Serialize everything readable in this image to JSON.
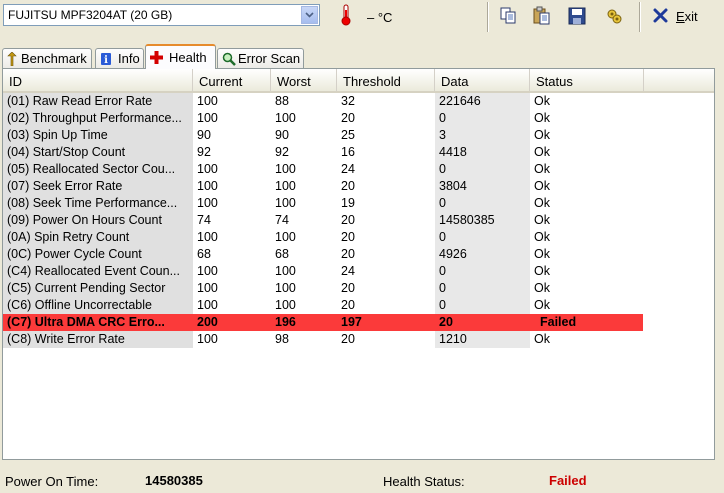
{
  "toolbar": {
    "drive": "FUJITSU MPF3204AT (20 GB)",
    "temperature": "– °C",
    "exit_label_first": "E",
    "exit_label_rest": "xit",
    "icons": [
      "copy-icon",
      "paste-icon",
      "save-icon",
      "options-icon",
      "exit-icon"
    ]
  },
  "tabs": [
    {
      "label": "Benchmark",
      "icon": "benchmark-icon",
      "active": false
    },
    {
      "label": "Info",
      "icon": "info-icon",
      "active": false
    },
    {
      "label": "Health",
      "icon": "health-cross-icon",
      "active": true
    },
    {
      "label": "Error Scan",
      "icon": "magnifier-icon",
      "active": false
    }
  ],
  "table": {
    "columns": [
      "ID",
      "Current",
      "Worst",
      "Threshold",
      "Data",
      "Status"
    ],
    "rows": [
      {
        "id": "(01) Raw Read Error Rate",
        "current": "100",
        "worst": "88",
        "threshold": "32",
        "data": "221646",
        "status": "Ok"
      },
      {
        "id": "(02) Throughput Performance...",
        "current": "100",
        "worst": "100",
        "threshold": "20",
        "data": "0",
        "status": "Ok"
      },
      {
        "id": "(03) Spin Up Time",
        "current": "90",
        "worst": "90",
        "threshold": "25",
        "data": "3",
        "status": "Ok"
      },
      {
        "id": "(04) Start/Stop Count",
        "current": "92",
        "worst": "92",
        "threshold": "16",
        "data": "4418",
        "status": "Ok"
      },
      {
        "id": "(05) Reallocated Sector Cou...",
        "current": "100",
        "worst": "100",
        "threshold": "24",
        "data": "0",
        "status": "Ok"
      },
      {
        "id": "(07) Seek Error Rate",
        "current": "100",
        "worst": "100",
        "threshold": "20",
        "data": "3804",
        "status": "Ok"
      },
      {
        "id": "(08) Seek Time Performance...",
        "current": "100",
        "worst": "100",
        "threshold": "19",
        "data": "0",
        "status": "Ok"
      },
      {
        "id": "(09) Power On Hours Count",
        "current": "74",
        "worst": "74",
        "threshold": "20",
        "data": "14580385",
        "status": "Ok"
      },
      {
        "id": "(0A) Spin Retry Count",
        "current": "100",
        "worst": "100",
        "threshold": "20",
        "data": "0",
        "status": "Ok"
      },
      {
        "id": "(0C) Power Cycle Count",
        "current": "68",
        "worst": "68",
        "threshold": "20",
        "data": "4926",
        "status": "Ok"
      },
      {
        "id": "(C4) Reallocated Event Coun...",
        "current": "100",
        "worst": "100",
        "threshold": "24",
        "data": "0",
        "status": "Ok"
      },
      {
        "id": "(C5) Current Pending Sector",
        "current": "100",
        "worst": "100",
        "threshold": "20",
        "data": "0",
        "status": "Ok"
      },
      {
        "id": "(C6) Offline Uncorrectable",
        "current": "100",
        "worst": "100",
        "threshold": "20",
        "data": "0",
        "status": "Ok"
      },
      {
        "id": "(C7) Ultra DMA CRC Erro...",
        "current": "200",
        "worst": "196",
        "threshold": "197",
        "data": "20",
        "status": "Failed",
        "failed": true
      },
      {
        "id": "(C8) Write Error Rate",
        "current": "100",
        "worst": "98",
        "threshold": "20",
        "data": "1210",
        "status": "Ok"
      }
    ]
  },
  "status_bar": {
    "power_on_label": "Power On Time:",
    "power_on_value": "14580385",
    "health_label": "Health Status:",
    "health_value": "Failed"
  },
  "colors": {
    "failed_row": "#fb3a3a",
    "failed_text": "#cc0000",
    "active_tab_accent": "#e68b2c"
  }
}
